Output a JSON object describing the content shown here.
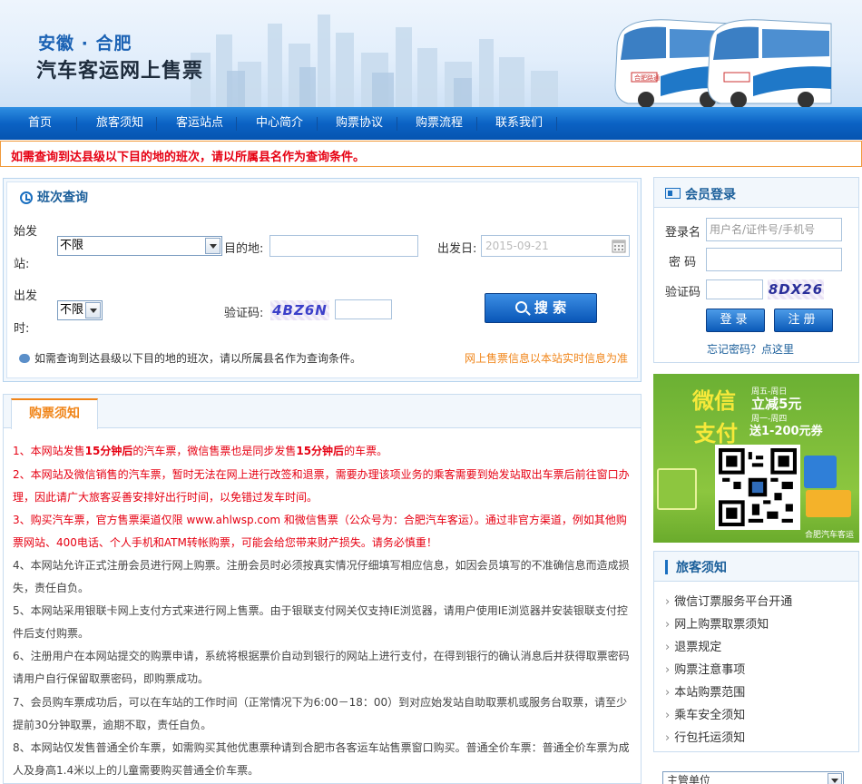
{
  "header": {
    "city": "安徽 · 合肥",
    "title": "汽车客运网上售票",
    "bus_sign": "合肥路通"
  },
  "nav": [
    "首页",
    "旅客须知",
    "客运站点",
    "中心简介",
    "购票协议",
    "购票流程",
    "联系我们"
  ],
  "notice_bar": "如需查询到达县级以下目的地的班次，请以所属县名作为查询条件。",
  "query": {
    "title": "班次查询",
    "depart_station_label_1": "始发",
    "depart_station_label_2": "站:",
    "depart_station_value": "不限",
    "destination_label": "目的地:",
    "destination_value": "",
    "date_label": "出发日:",
    "date_value": "2015-09-21",
    "depart_time_label_1": "出发",
    "depart_time_label_2": "时:",
    "depart_time_value": "不限",
    "captcha_label": "验证码:",
    "captcha_text": "4BZ6N",
    "search_button": "搜 索",
    "tip": "如需查询到达县级以下目的地的班次，请以所属县名作为查询条件。",
    "tip_right": "网上售票信息以本站实时信息为准"
  },
  "purchase": {
    "tab": "购票须知",
    "items": [
      {
        "pre": "1、本网站发售",
        "b1": "15分钟后",
        "mid": "的汽车票，微信售票也是同步发售",
        "b2": "15分钟后",
        "post": "的车票。"
      },
      {
        "text": "2、本网站及微信销售的汽车票，暂时无法在网上进行改签和退票，需要办理该项业务的乘客需要到始发站取出车票后前往窗口办理，因此请广大旅客妥善安排好出行时间，以免错过发车时间。"
      },
      {
        "text": "3、购买汽车票，官方售票渠道仅限 www.ahlwsp.com 和微信售票（公众号为：合肥汽车客运）。通过非官方渠道，例如其他购票网站、400电话、个人手机和ATM转帐购票，可能会给您带来财产损失。请务必慎重！"
      },
      {
        "text": "4、本网站允许正式注册会员进行网上购票。注册会员时必须按真实情况仔细填写相应信息，如因会员填写的不准确信息而造成损失，责任自负。"
      },
      {
        "text": "5、本网站采用银联卡网上支付方式来进行网上售票。由于银联支付网关仅支持IE浏览器，请用户使用IE浏览器并安装银联支付控件后支付购票。"
      },
      {
        "text": "6、注册用户在本网站提交的购票申请，系统将根据票价自动到银行的网站上进行支付，在得到银行的确认消息后并获得取票密码请用户自行保留取票密码，即购票成功。"
      },
      {
        "text": "7、会员购车票成功后，可以在车站的工作时间（正常情况下为6:00－18：00）到对应始发站自助取票机或服务台取票，请至少提前30分钟取票，逾期不取，责任自负。"
      },
      {
        "text": "8、本网站仅发售普通全价车票，如需购买其他优惠票种请到合肥市各客运车站售票窗口购买。普通全价车票：普通全价车票为成人及身高1.4米以上的儿童需要购买普通全价车票。"
      }
    ]
  },
  "login": {
    "title": "会员登录",
    "username_label": "登录名",
    "username_placeholder": "用户名/证件号/手机号",
    "password_label": "密 码",
    "captcha_label": "验证码",
    "captcha_text": "8DX26",
    "login_button": "登录",
    "register_button": "注册",
    "forgot": "忘记密码？点这里"
  },
  "promo": {
    "line1": "微信",
    "line2": "支付",
    "small1": "周五-周日",
    "small2": "立减5元",
    "small3": "周一-周四",
    "small4": "送1-200元券",
    "footer": "合肥汽车客运"
  },
  "guide": {
    "title": "旅客须知",
    "items": [
      "微信订票服务平台开通",
      "网上购票取票须知",
      "退票规定",
      "购票注意事项",
      "本站购票范围",
      "乘车安全须知",
      "行包托运须知"
    ]
  },
  "unit_select": "主管单位",
  "colors": {
    "nav_blue": "#0b62c4",
    "accent_orange": "#f08519",
    "alert_red": "#e60012",
    "title_blue": "#1a5e9a"
  }
}
